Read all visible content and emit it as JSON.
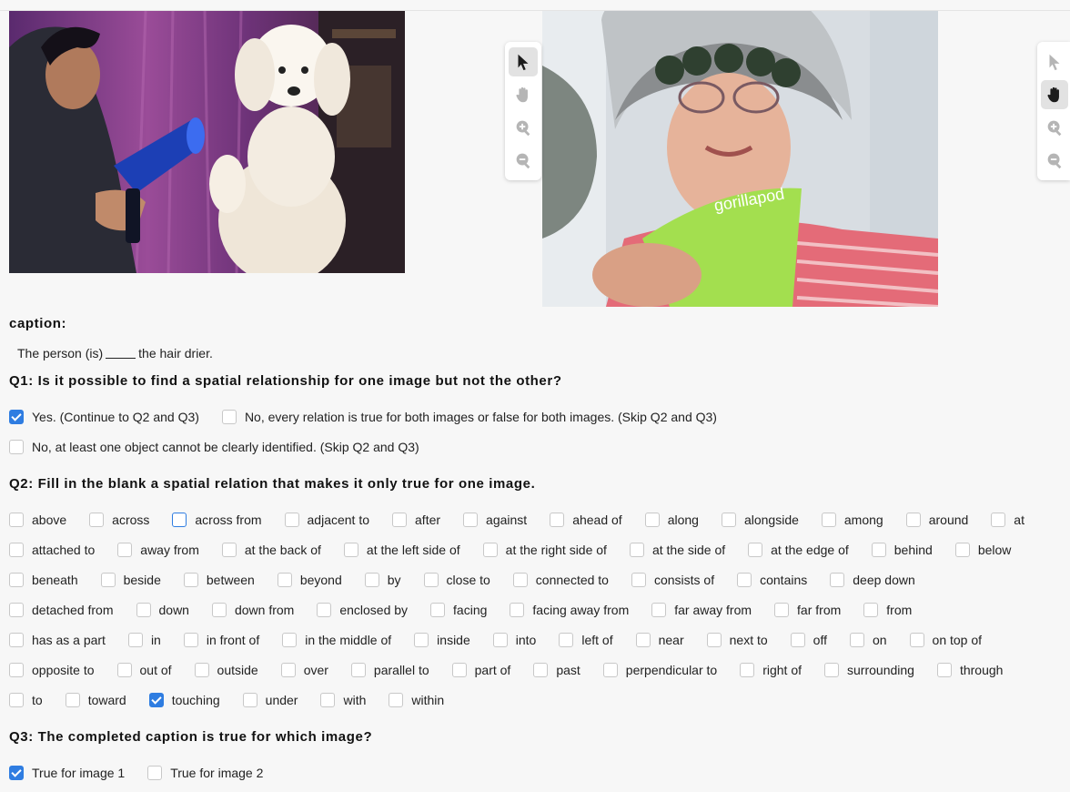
{
  "caption": {
    "heading": "caption:",
    "before_blank": "The person (is)",
    "after_blank": "the hair drier."
  },
  "q1": {
    "heading": "Q1: Is it possible to find a spatial relationship for one image but not the other?",
    "options": [
      {
        "label": "Yes. (Continue to Q2 and Q3)",
        "checked": true
      },
      {
        "label": "No, every relation is true for both images or false for both images. (Skip Q2 and Q3)",
        "checked": false
      },
      {
        "label": "No, at least one object cannot be clearly identified. (Skip Q2 and Q3)",
        "checked": false
      }
    ]
  },
  "q2": {
    "heading": "Q2: Fill in the blank a spatial relation that makes it only true for one image.",
    "rows": [
      [
        "above",
        "across",
        "across from",
        "adjacent to",
        "after",
        "against",
        "ahead of",
        "along",
        "alongside",
        "among",
        "around",
        "at"
      ],
      [
        "attached to",
        "away from",
        "at the back of",
        "at the left side of",
        "at the right side of",
        "at the side of",
        "at the edge of",
        "behind",
        "below"
      ],
      [
        "beneath",
        "beside",
        "between",
        "beyond",
        "by",
        "close to",
        "connected to",
        "consists of",
        "contains",
        "deep down"
      ],
      [
        "detached from",
        "down",
        "down from",
        "enclosed by",
        "facing",
        "facing away from",
        "far away from",
        "far from",
        "from"
      ],
      [
        "has as a part",
        "in",
        "in front of",
        "in the middle of",
        "inside",
        "into",
        "left of",
        "near",
        "next to",
        "off",
        "on",
        "on top of"
      ],
      [
        "opposite to",
        "out of",
        "outside",
        "over",
        "parallel to",
        "part of",
        "past",
        "perpendicular to",
        "right of",
        "surrounding",
        "through"
      ],
      [
        "to",
        "toward",
        "touching",
        "under",
        "with",
        "within"
      ]
    ],
    "selected": "touching",
    "focused": "across from"
  },
  "q3": {
    "heading": "Q3: The completed caption is true for which image?",
    "options": [
      {
        "label": "True for image 1",
        "checked": true
      },
      {
        "label": "True for image 2",
        "checked": false
      }
    ]
  },
  "toolbar": {
    "tools": [
      "pointer-icon",
      "hand-pan-icon",
      "zoom-in-icon",
      "zoom-out-icon"
    ],
    "image1_active": "pointer-icon",
    "image2_active": "hand-pan-icon"
  },
  "colors": {
    "accent": "#2f7de1",
    "background": "#f7f7f7"
  }
}
